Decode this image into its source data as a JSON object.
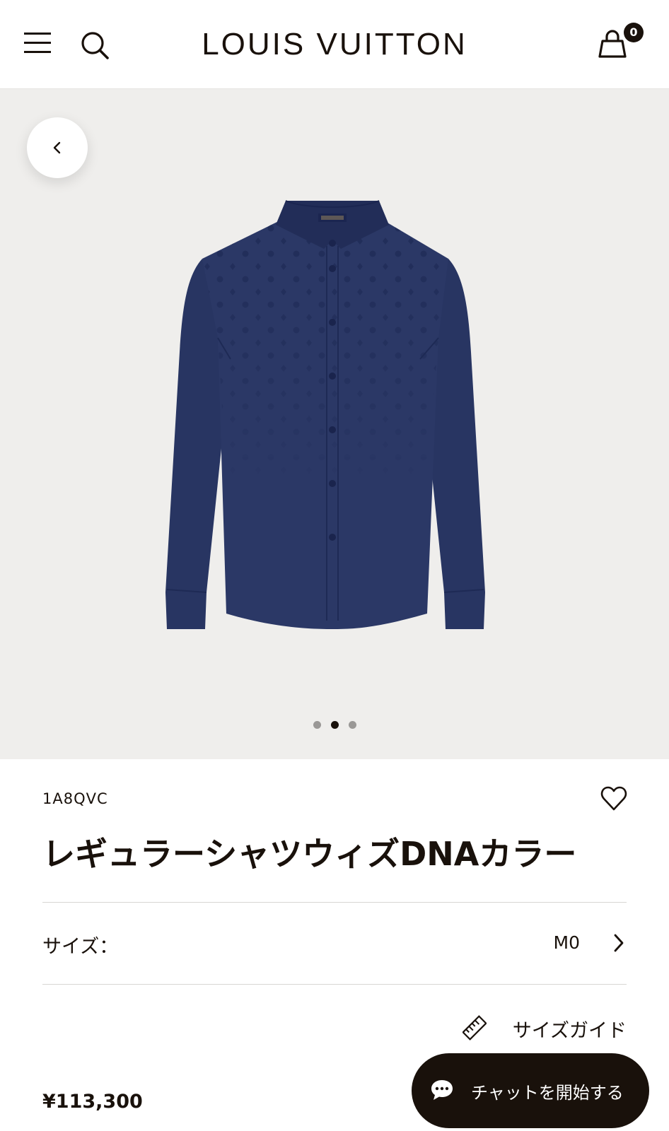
{
  "header": {
    "brand": "LOUIS VUITTON",
    "cart_count": "0",
    "menu_icon": "hamburger-icon",
    "search_icon": "search-icon",
    "cart_icon": "shopping-bag-icon"
  },
  "gallery": {
    "back_icon": "chevron-left-icon",
    "image_subject": "navy long-sleeve shirt",
    "pagination": {
      "total": 3,
      "active_index": 2
    }
  },
  "product": {
    "sku": "1A8QVC",
    "title": "レギュラーシャツウィズDNAカラー",
    "wishlist_icon": "heart-icon",
    "size_label": "サイズ：",
    "size_value": "M0",
    "size_guide_label": "サイズガイド",
    "size_guide_icon": "ruler-icon",
    "price": "¥113,300"
  },
  "chat": {
    "label": "チャットを開始する",
    "icon": "chat-bubble-icon"
  },
  "colors": {
    "text": "#19110b",
    "gallery_bg": "#efeeec",
    "shirt": "#283562",
    "chat_bg": "#19110b"
  }
}
